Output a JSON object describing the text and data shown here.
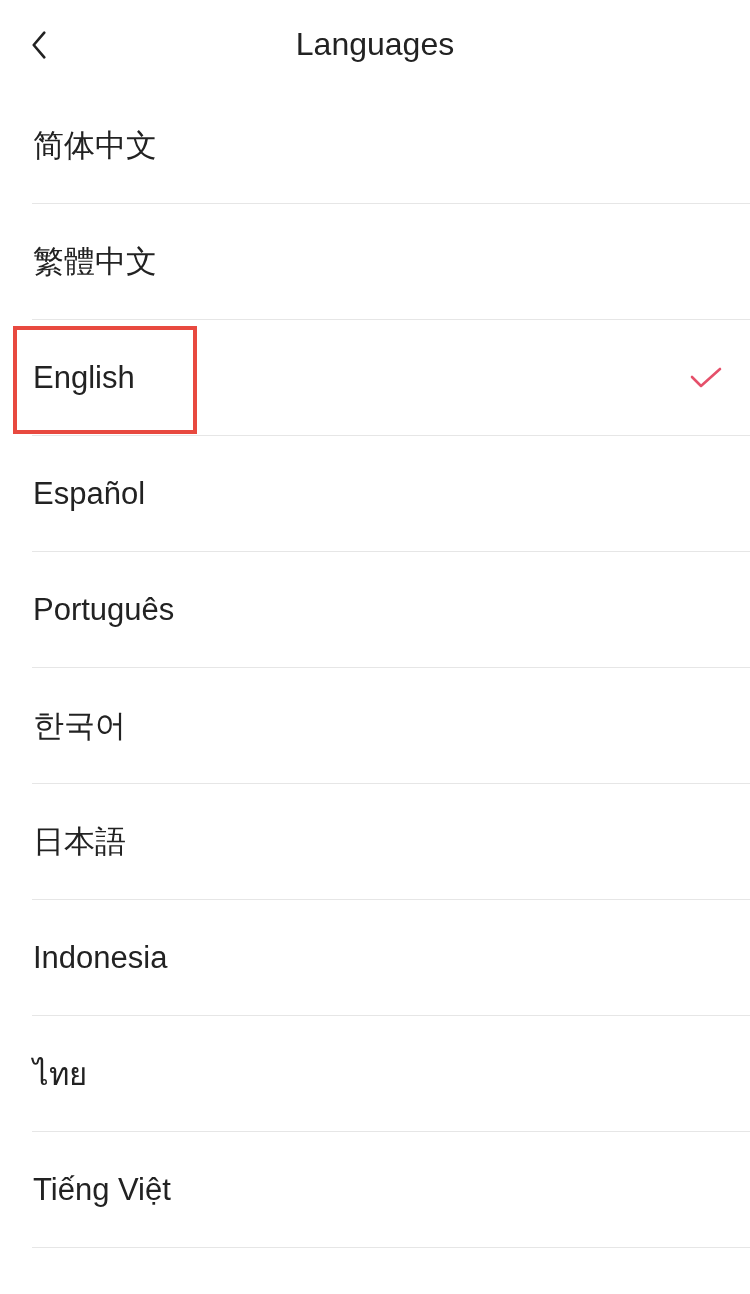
{
  "header": {
    "title": "Languages"
  },
  "languages": [
    {
      "label": "简体中文",
      "selected": false,
      "highlighted": false
    },
    {
      "label": "繁體中文",
      "selected": false,
      "highlighted": false
    },
    {
      "label": "English",
      "selected": true,
      "highlighted": true
    },
    {
      "label": "Español",
      "selected": false,
      "highlighted": false
    },
    {
      "label": "Português",
      "selected": false,
      "highlighted": false
    },
    {
      "label": "한국어",
      "selected": false,
      "highlighted": false
    },
    {
      "label": "日本語",
      "selected": false,
      "highlighted": false
    },
    {
      "label": "Indonesia",
      "selected": false,
      "highlighted": false
    },
    {
      "label": "ไทย",
      "selected": false,
      "highlighted": false
    },
    {
      "label": "Tiếng Việt",
      "selected": false,
      "highlighted": false
    }
  ]
}
